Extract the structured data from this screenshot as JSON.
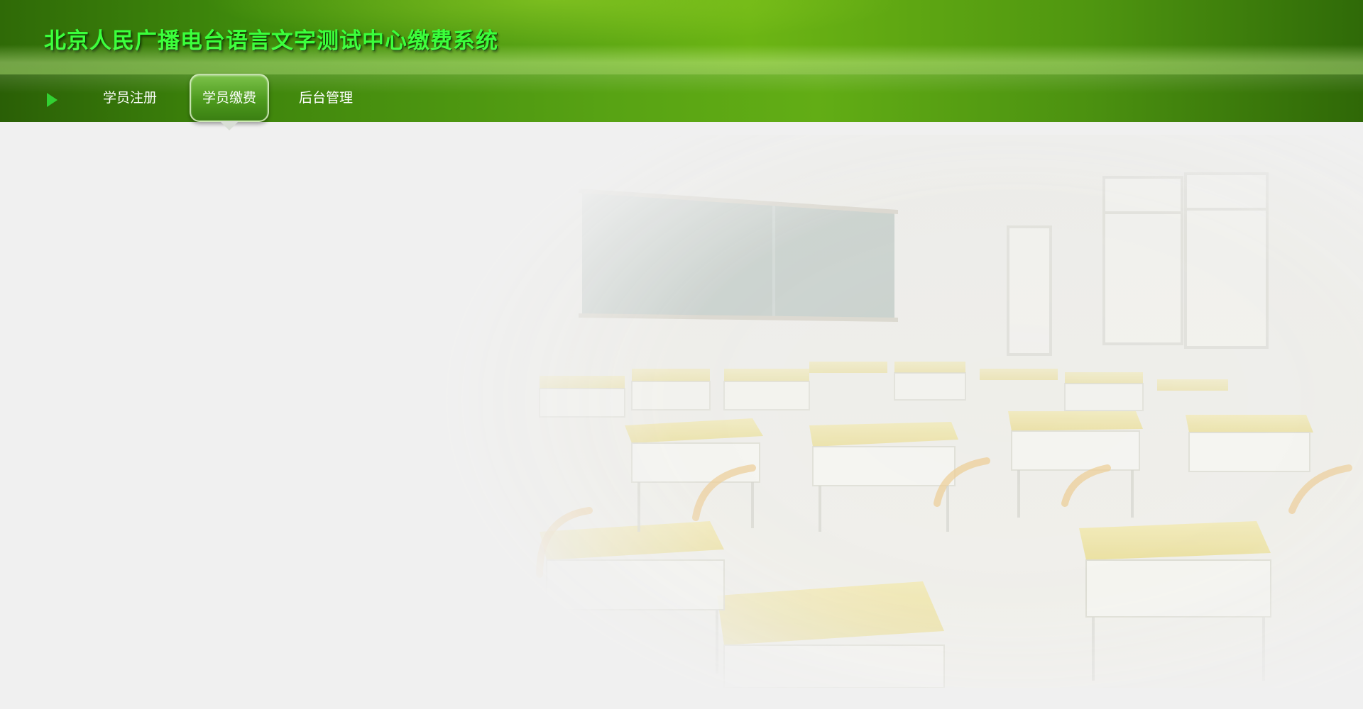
{
  "header": {
    "title": "北京人民广播电台语言文字测试中心缴费系统"
  },
  "nav": {
    "items": [
      {
        "label": "学员注册",
        "active": false
      },
      {
        "label": "学员缴费",
        "active": true
      },
      {
        "label": "后台管理",
        "active": false
      }
    ]
  },
  "colors": {
    "header_green": "#4f9a12",
    "title_text": "#3bff3b",
    "nav_text": "#ffffff",
    "page_background": "#f0f0f0"
  }
}
